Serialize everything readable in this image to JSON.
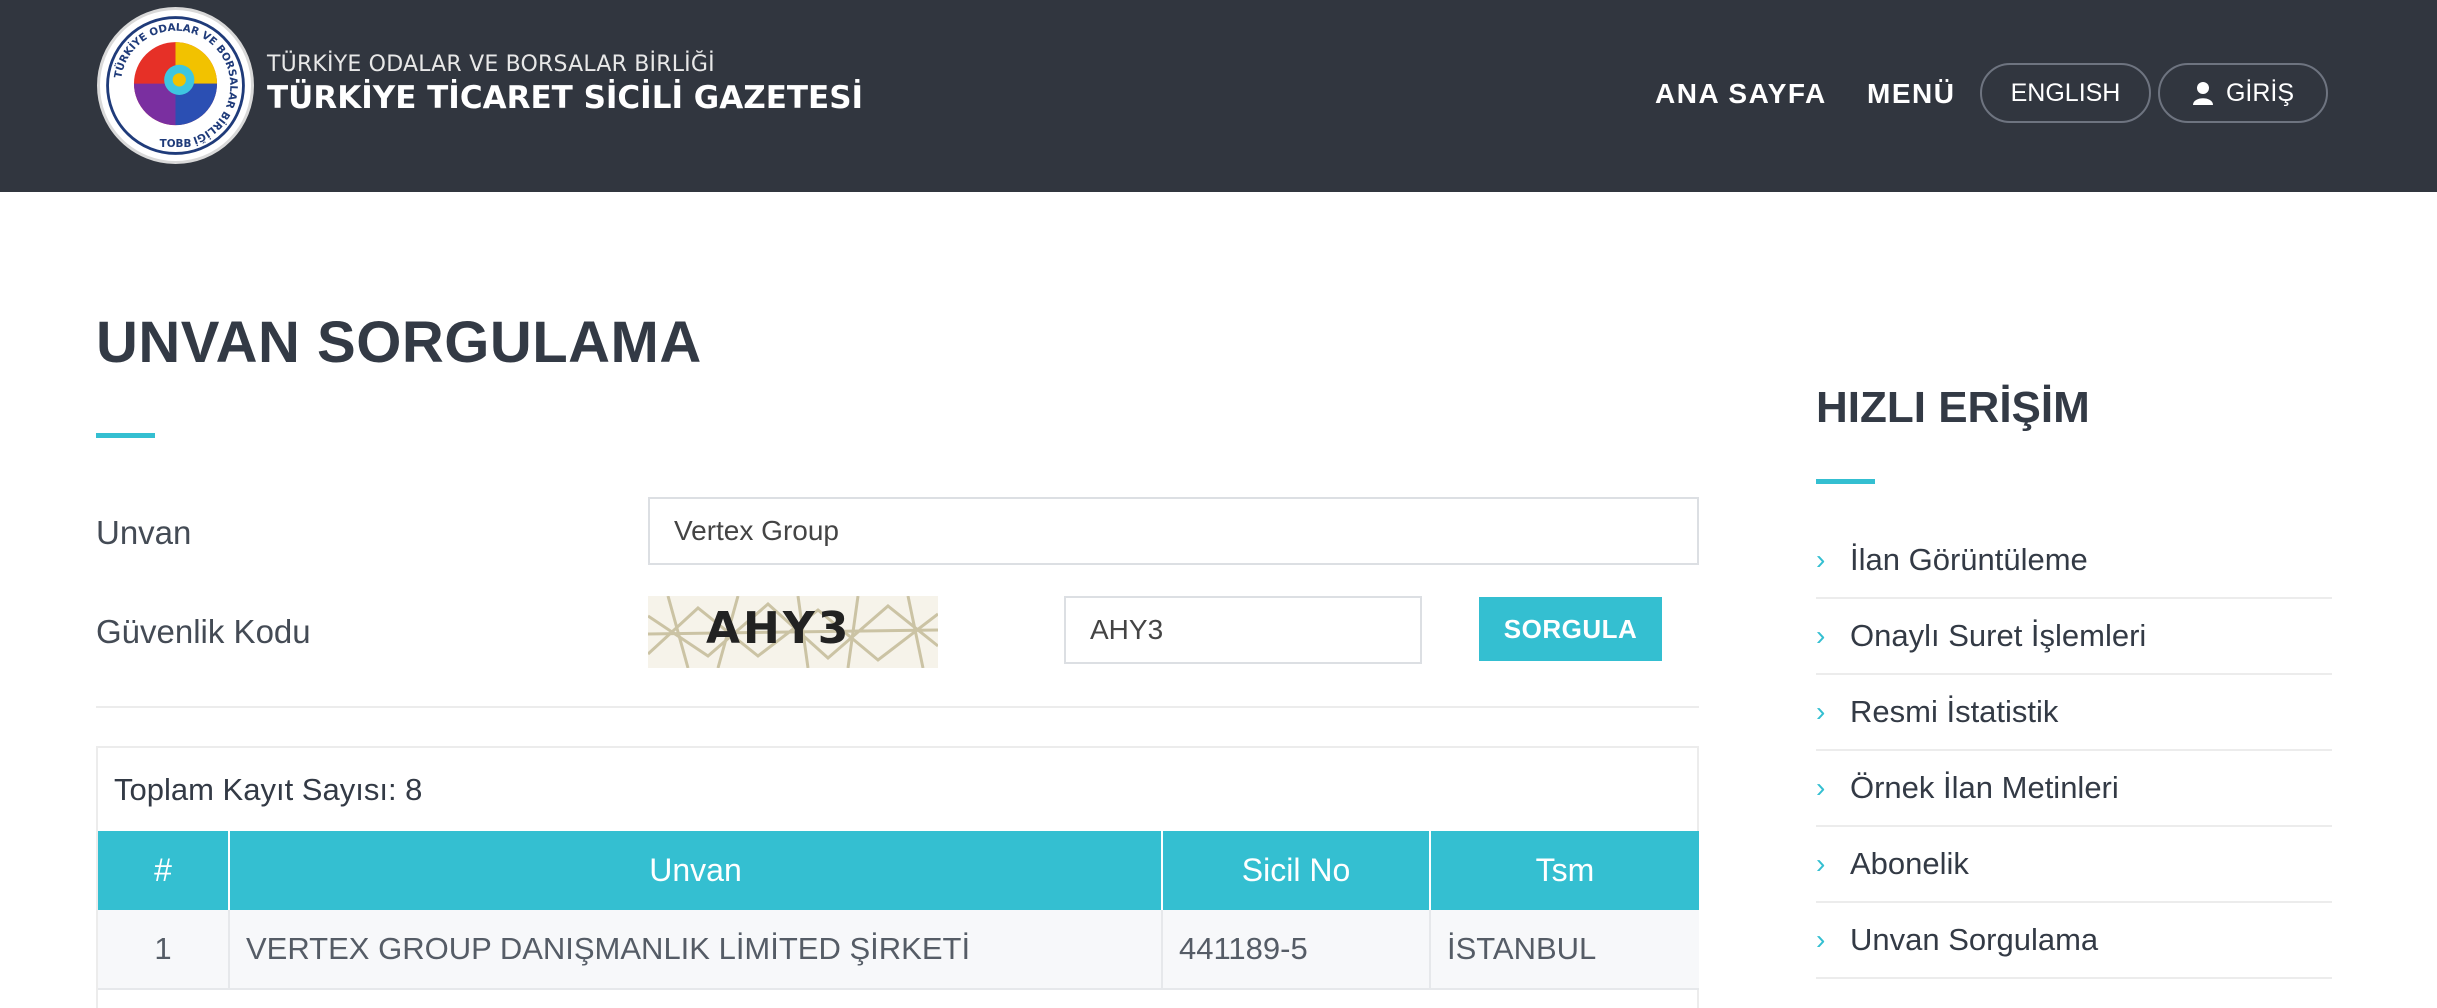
{
  "header": {
    "logo_text": "TÜRKİYE ODALAR VE BORSALAR BİRLİĞİ · TOBB",
    "brand_sub": "TÜRKİYE ODALAR VE BORSALAR BİRLİĞİ",
    "brand_main": "TÜRKİYE TİCARET SİCİLİ GAZETESİ",
    "nav": {
      "home": "ANA SAYFA",
      "menu": "MENÜ",
      "english": "ENGLISH",
      "login": "GİRİŞ"
    }
  },
  "main": {
    "title": "UNVAN SORGULAMA",
    "form": {
      "unvan_label": "Unvan",
      "unvan_value": "Vertex Group",
      "security_label": "Güvenlik Kodu",
      "captcha_text": "AHY3",
      "security_value": "AHY3",
      "submit_label": "SORGULA"
    },
    "results": {
      "total_label": "Toplam Kayıt Sayısı: 8",
      "columns": [
        "#",
        "Unvan",
        "Sicil No",
        "Tsm"
      ],
      "rows": [
        [
          "1",
          "VERTEX GROUP DANIŞMANLIK LİMİTED ŞİRKETİ",
          "441189-5",
          "İSTANBUL"
        ]
      ]
    }
  },
  "sidebar": {
    "title": "HIZLI ERİŞİM",
    "items": [
      {
        "label": "İlan Görüntüleme"
      },
      {
        "label": "Onaylı Suret İşlemleri"
      },
      {
        "label": "Resmi İstatistik"
      },
      {
        "label": "Örnek İlan Metinleri"
      },
      {
        "label": "Abonelik"
      },
      {
        "label": "Unvan Sorgulama"
      }
    ]
  },
  "colors": {
    "header_bg": "#31363f",
    "accent": "#34bfd1",
    "text": "#333a45"
  },
  "icons": {
    "nav_chevron": "chevron-right-icon",
    "login": "user-icon"
  }
}
